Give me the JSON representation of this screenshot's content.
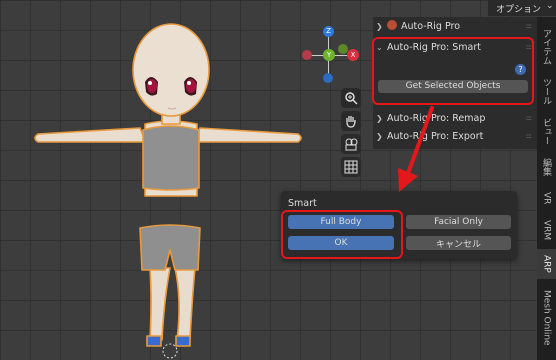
{
  "header": {
    "options_label": "オプション"
  },
  "npanel": {
    "panels": [
      {
        "title": "Auto-Rig Pro"
      },
      {
        "title": "Auto-Rig Pro: Smart"
      },
      {
        "title": "Auto-Rig Pro: Remap"
      },
      {
        "title": "Auto-Rig Pro: Export"
      }
    ],
    "get_selected_label": "Get Selected Objects",
    "help_label": "?"
  },
  "tabs": [
    "アイテム",
    "ツール",
    "ビュー",
    "編集",
    "VR",
    "VRM",
    "ARP",
    "Mesh Online"
  ],
  "popup": {
    "title": "Smart",
    "full_body": "Full Body",
    "facial_only": "Facial Only",
    "ok": "OK",
    "cancel": "キャンセル"
  },
  "gizmo": {
    "z": "Z",
    "y": "Y",
    "x": "X"
  },
  "colors": {
    "red_highlight": "#e4181b",
    "active_button": "#4772b3",
    "outline": "#e8a040"
  }
}
